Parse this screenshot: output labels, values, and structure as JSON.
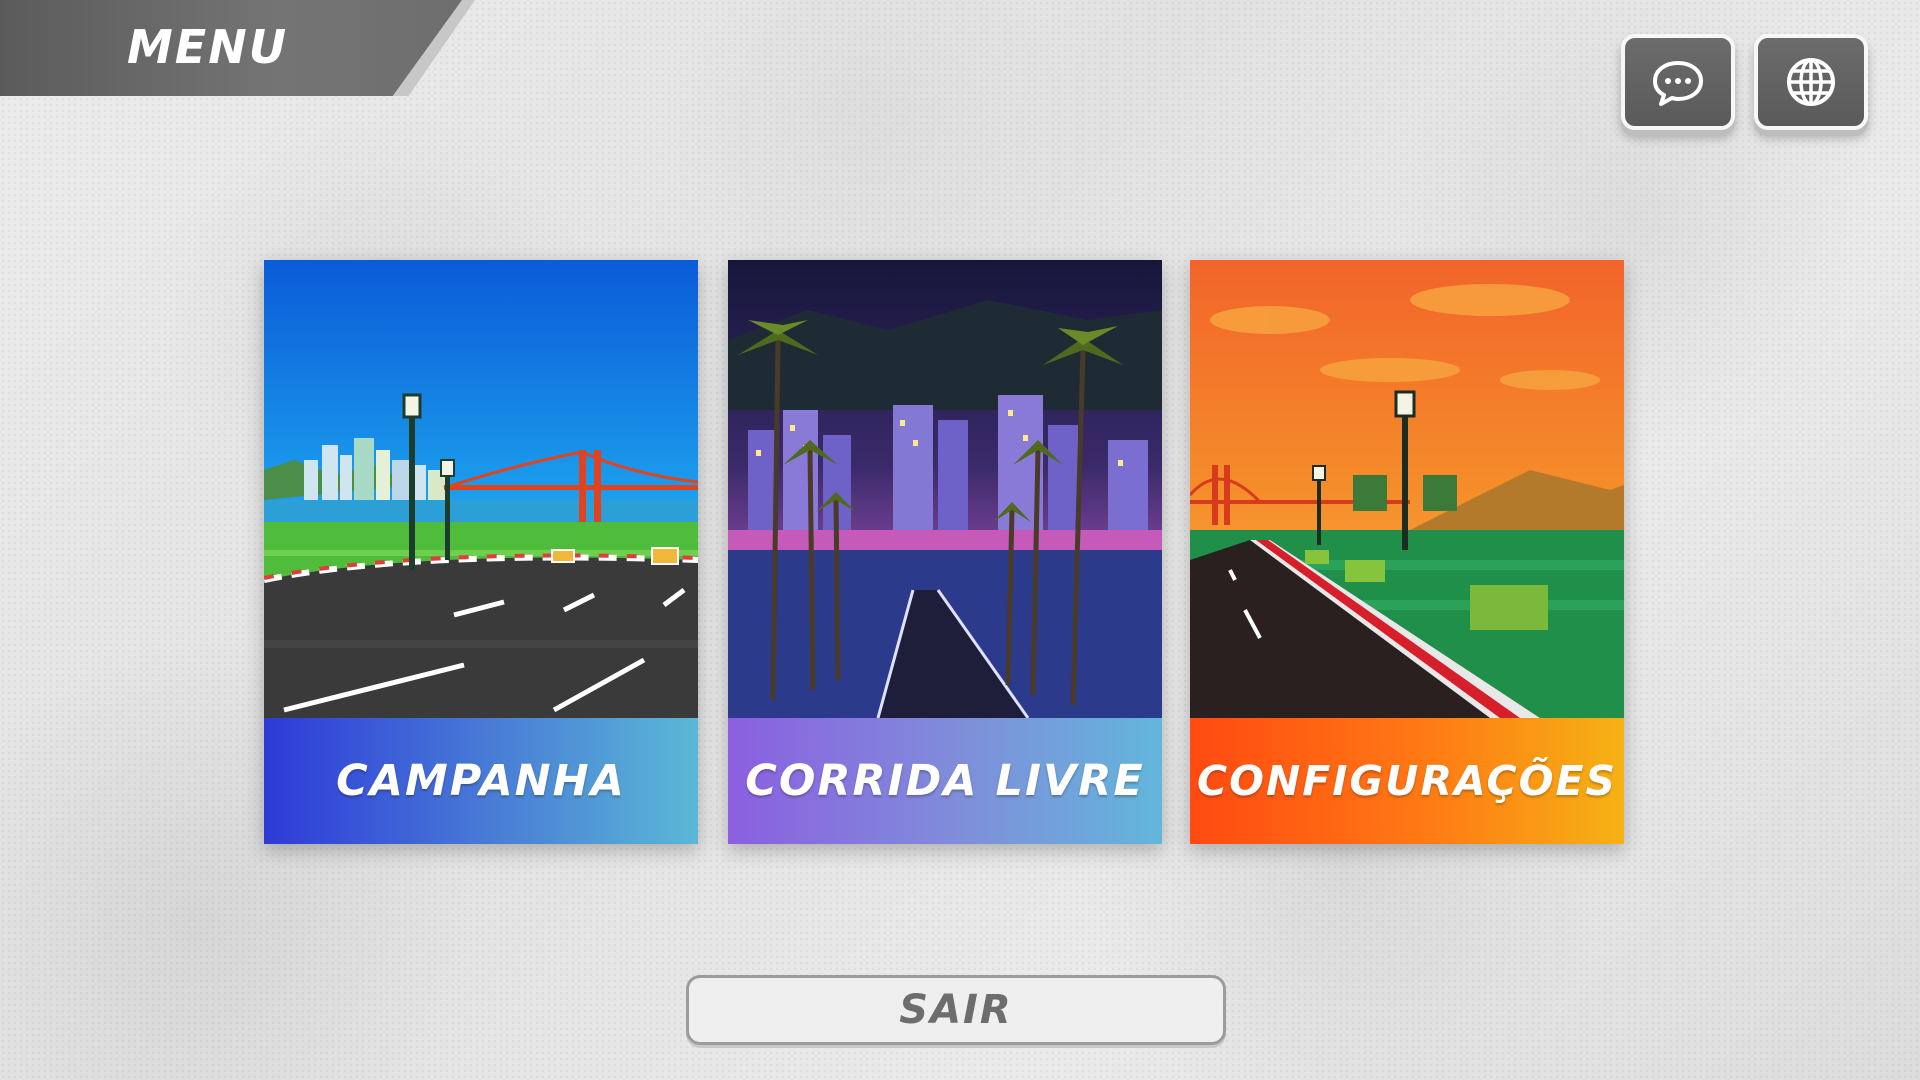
{
  "header": {
    "menu_title": "MENU"
  },
  "top_actions": {
    "chat_icon": "chat-bubble-icon",
    "language_icon": "globe-icon"
  },
  "cards": [
    {
      "label": "CAMPANHA",
      "scene": "daytime-bay-bridge-road"
    },
    {
      "label": "CORRIDA LIVRE",
      "scene": "night-city-palm-road"
    },
    {
      "label": "CONFIGURAÇÕES",
      "scene": "sunset-bridge-road"
    }
  ],
  "exit": {
    "label": "SAIR"
  },
  "colors": {
    "banner_dark": "#6b6b6b",
    "campanha_gradient": [
      "#2e3ad8",
      "#5ab8d6"
    ],
    "livre_gradient": [
      "#8b5fe0",
      "#62b6dc"
    ],
    "config_gradient": [
      "#ff4a12",
      "#f5b214"
    ],
    "exit_text": "#6d6d6d"
  }
}
